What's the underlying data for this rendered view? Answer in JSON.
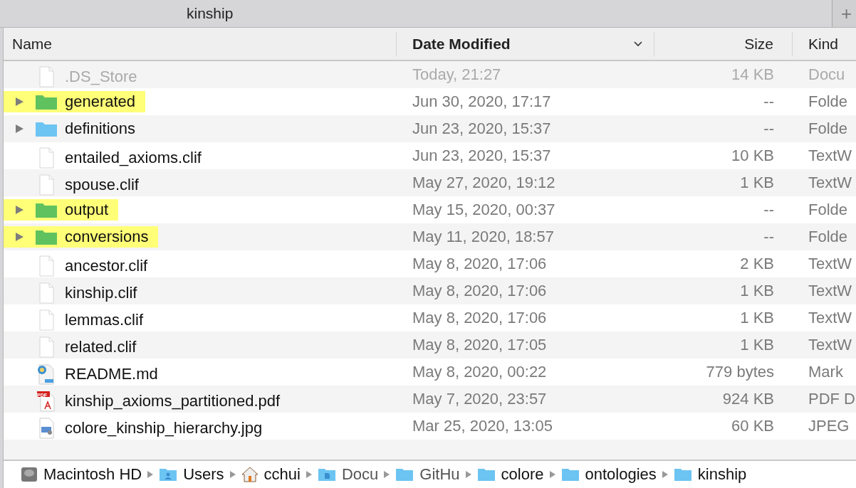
{
  "window": {
    "title": "kinship",
    "new_tab": "+"
  },
  "table": {
    "columns": [
      {
        "label": "Name",
        "sorted": false
      },
      {
        "label": "Date Modified",
        "sorted": true
      },
      {
        "label": "Size",
        "sorted": false
      },
      {
        "label": "Kind",
        "sorted": false
      }
    ],
    "rows": [
      {
        "kind": "file",
        "name": ".DS_Store",
        "date": "Today, 21:27",
        "size": "14 KB",
        "type": "Docu",
        "dimmed": true,
        "highlighted": false,
        "expandable": false
      },
      {
        "kind": "folder",
        "color": "#5fc25f",
        "name": "generated",
        "date": "Jun 30, 2020, 17:17",
        "size": "--",
        "type": "Folde",
        "dimmed": false,
        "highlighted": true,
        "expandable": true
      },
      {
        "kind": "folder",
        "color": "#6cc4f2",
        "name": "definitions",
        "date": "Jun 23, 2020, 15:37",
        "size": "--",
        "type": "Folde",
        "dimmed": false,
        "highlighted": false,
        "expandable": true
      },
      {
        "kind": "file",
        "name": "entailed_axioms.clif",
        "date": "Jun 23, 2020, 15:37",
        "size": "10 KB",
        "type": "TextW",
        "dimmed": false,
        "highlighted": false,
        "expandable": false
      },
      {
        "kind": "file",
        "name": "spouse.clif",
        "date": "May 27, 2020, 19:12",
        "size": "1 KB",
        "type": "TextW",
        "dimmed": false,
        "highlighted": false,
        "expandable": false
      },
      {
        "kind": "folder",
        "color": "#5fc25f",
        "name": "output",
        "date": "May 15, 2020, 00:37",
        "size": "--",
        "type": "Folde",
        "dimmed": false,
        "highlighted": true,
        "expandable": true
      },
      {
        "kind": "folder",
        "color": "#5fc25f",
        "name": "conversions",
        "date": "May 11, 2020, 18:57",
        "size": "--",
        "type": "Folde",
        "dimmed": false,
        "highlighted": true,
        "expandable": true
      },
      {
        "kind": "file",
        "name": "ancestor.clif",
        "date": "May 8, 2020, 17:06",
        "size": "2 KB",
        "type": "TextW",
        "dimmed": false,
        "highlighted": false,
        "expandable": false
      },
      {
        "kind": "file",
        "name": "kinship.clif",
        "date": "May 8, 2020, 17:06",
        "size": "1 KB",
        "type": "TextW",
        "dimmed": false,
        "highlighted": false,
        "expandable": false
      },
      {
        "kind": "file",
        "name": "lemmas.clif",
        "date": "May 8, 2020, 17:06",
        "size": "1 KB",
        "type": "TextW",
        "dimmed": false,
        "highlighted": false,
        "expandable": false
      },
      {
        "kind": "file",
        "name": "related.clif",
        "date": "May 8, 2020, 17:05",
        "size": "1 KB",
        "type": "TextW",
        "dimmed": false,
        "highlighted": false,
        "expandable": false
      },
      {
        "kind": "readme",
        "name": "README.md",
        "date": "May 8, 2020, 00:22",
        "size": "779 bytes",
        "type": "Mark",
        "dimmed": false,
        "highlighted": false,
        "expandable": false
      },
      {
        "kind": "pdf",
        "name": "kinship_axioms_partitioned.pdf",
        "date": "May 7, 2020, 23:57",
        "size": "924 KB",
        "type": "PDF D",
        "dimmed": false,
        "highlighted": false,
        "expandable": false,
        "badge": "PDF"
      },
      {
        "kind": "image",
        "name": "colore_kinship_hierarchy.jpg",
        "date": "Mar 25, 2020, 13:05",
        "size": "60 KB",
        "type": "JPEG",
        "dimmed": false,
        "highlighted": false,
        "expandable": false
      }
    ]
  },
  "path_bar": [
    {
      "kind": "disk",
      "label": "Macintosh HD",
      "faded": false
    },
    {
      "kind": "users",
      "label": "Users",
      "faded": false
    },
    {
      "kind": "home",
      "label": "cchui",
      "faded": false
    },
    {
      "kind": "documents",
      "label": "Docu",
      "faded": true
    },
    {
      "kind": "folder",
      "label": "GitHu",
      "faded": true
    },
    {
      "kind": "folder",
      "label": "colore",
      "faded": false
    },
    {
      "kind": "folder",
      "label": "ontologies",
      "faded": false
    },
    {
      "kind": "folder",
      "label": "kinship",
      "faded": false
    }
  ]
}
